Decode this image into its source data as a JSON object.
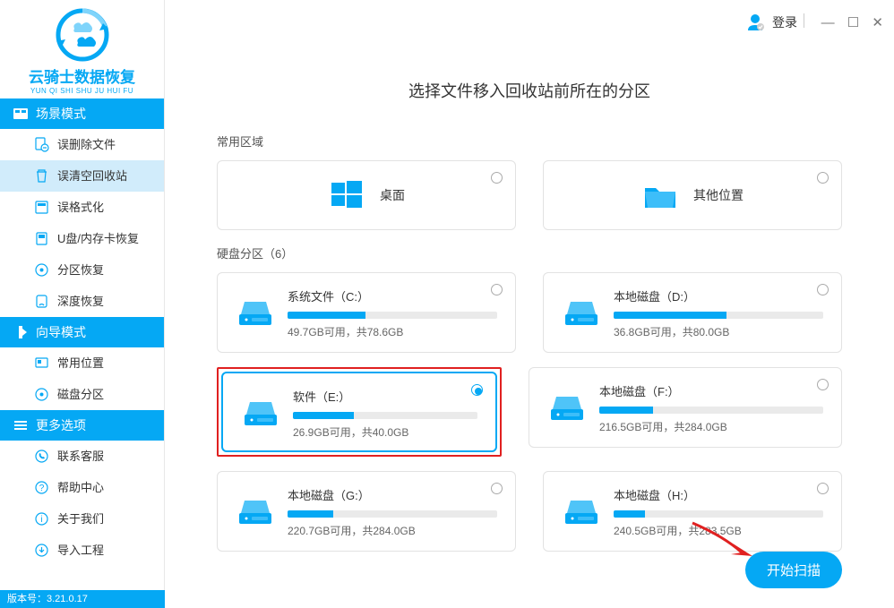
{
  "app": {
    "logo_title": "云骑士数据恢复",
    "logo_sub": "YUN QI SHI SHU JU HUI FU",
    "version_label": "版本号：3.21.0.17"
  },
  "sidebar": {
    "groups": [
      {
        "label": "场景模式",
        "items": [
          {
            "label": "误删除文件"
          },
          {
            "label": "误清空回收站",
            "active": true
          },
          {
            "label": "误格式化"
          },
          {
            "label": "U盘/内存卡恢复"
          },
          {
            "label": "分区恢复"
          },
          {
            "label": "深度恢复"
          }
        ]
      },
      {
        "label": "向导模式",
        "items": [
          {
            "label": "常用位置"
          },
          {
            "label": "磁盘分区"
          }
        ]
      },
      {
        "label": "更多选项",
        "items": [
          {
            "label": "联系客服"
          },
          {
            "label": "帮助中心"
          },
          {
            "label": "关于我们"
          },
          {
            "label": "导入工程"
          }
        ]
      }
    ]
  },
  "topbar": {
    "login": "登录"
  },
  "main": {
    "title": "选择文件移入回收站前所在的分区",
    "section_common": "常用区域",
    "section_drives_prefix": "硬盘分区（",
    "section_drives_count": "6",
    "section_drives_suffix": "）",
    "common": [
      {
        "label": "桌面",
        "icon": "windows"
      },
      {
        "label": "其他位置",
        "icon": "folder"
      }
    ],
    "drives": [
      {
        "name": "系统文件（C:）",
        "stats": "49.7GB可用，共78.6GB",
        "fill": 37
      },
      {
        "name": "本地磁盘（D:）",
        "stats": "36.8GB可用，共80.0GB",
        "fill": 54
      },
      {
        "name": "软件（E:）",
        "stats": "26.9GB可用，共40.0GB",
        "fill": 33,
        "selected": true,
        "red": true
      },
      {
        "name": "本地磁盘（F:）",
        "stats": "216.5GB可用，共284.0GB",
        "fill": 24
      },
      {
        "name": "本地磁盘（G:）",
        "stats": "220.7GB可用，共284.0GB",
        "fill": 22
      },
      {
        "name": "本地磁盘（H:）",
        "stats": "240.5GB可用，共283.5GB",
        "fill": 15
      }
    ],
    "scan_btn": "开始扫描"
  }
}
